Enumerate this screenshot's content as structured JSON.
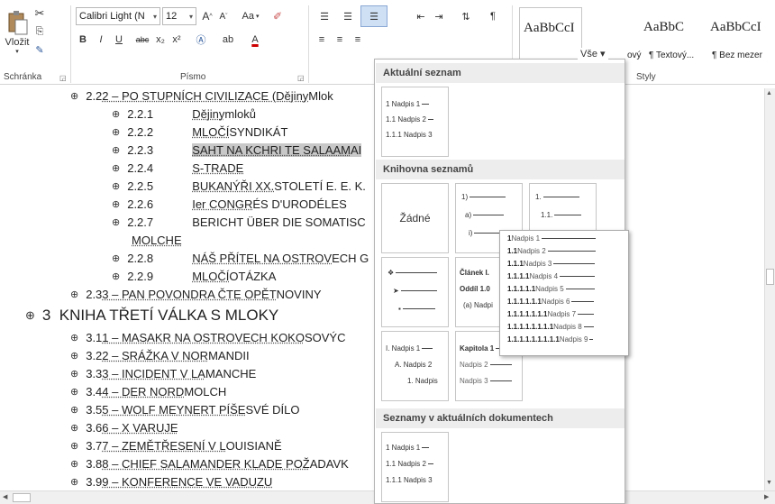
{
  "ribbon": {
    "clipboard": {
      "paste_label": "Vložit",
      "group_label": "Schránka"
    },
    "font": {
      "font_name": "Calibri Light (N",
      "font_size": "12",
      "group_label": "Písmo",
      "change_case": "Aa",
      "format_buttons": [
        "B",
        "I",
        "U",
        "abc",
        "x₂",
        "x²"
      ]
    },
    "paragraph": {
      "group_label": ""
    },
    "styles": {
      "group_label": "Styly",
      "gallery": [
        {
          "preview": "AaBbCcI",
          "name": ""
        },
        {
          "preview": "AaBbC`",
          "name": "ový"
        },
        {
          "preview": "AaBbC`",
          "name": "¶ Textový..."
        },
        {
          "preview": "AaBbCcI",
          "name": "¶ Bez mezer"
        }
      ]
    }
  },
  "document": {
    "lines": [
      {
        "id": "l1",
        "num": "2.22",
        "text_pre": "2.2",
        "text_u": "2 – PO STUPNÍCH CIVILIZACE (Dějiny",
        "text_post": " Mlok"
      },
      {
        "id": "l2",
        "num": "2.2.1",
        "title_u": "Dějiny",
        "title_post": " mloků"
      },
      {
        "id": "l3",
        "num": "2.2.2",
        "title_u": "MLOČÍ",
        "title_post": " SYNDIKÁT"
      },
      {
        "id": "l4",
        "num": "2.2.3",
        "title_u": "SAHT NA KCHRI TE SALAAM",
        "title_post": " AI"
      },
      {
        "id": "l5",
        "num": "2.2.4",
        "title_u": "S-TRADE",
        "title_post": ""
      },
      {
        "id": "l6",
        "num": "2.2.5",
        "title_u": "BUKANÝŘI XX.",
        "title_post": " STOLETÍ E. E. K."
      },
      {
        "id": "l7",
        "num": "2.2.6",
        "title_u": "Ier CONGR",
        "title_post": "ÉS D'URODÉLES"
      },
      {
        "id": "l8",
        "num": "2.2.7",
        "title_u": "",
        "title_post": "BERICHT ÜBER DIE SOMATISC"
      },
      {
        "id": "l8b",
        "text": "MOLCHE"
      },
      {
        "id": "l9",
        "num": "2.2.8",
        "title_u": "NÁŠ PŘÍTEL NA OSTROV",
        "title_post": "ECH G"
      },
      {
        "id": "l10",
        "num": "2.2.9",
        "title_u": "MLOČÍ",
        "title_post": " OTÁZKA"
      },
      {
        "id": "l11",
        "text_pre": "2.3",
        "text_u": "3 – PAN POVONDRA ČTE OPĚT",
        "text_post": " NOVINY"
      },
      {
        "id": "h3",
        "text": "3  KNIHA TŘETÍ VÁLKA S MLOKY"
      },
      {
        "id": "l12",
        "text_pre": "3.1",
        "text_u": "1 – MASAKR NA OSTROVECH KOKO",
        "text_post": "SOVÝC"
      },
      {
        "id": "l13",
        "text_pre": "3.2",
        "text_u": "2 – SRÁŽKA V NOR",
        "text_post": "MANDII"
      },
      {
        "id": "l14",
        "text_pre": "3.3",
        "text_u": "3 – INCIDENT V LA ",
        "text_post": "MANCHE"
      },
      {
        "id": "l15",
        "text_pre": "3.4",
        "text_u": "4 – DER NORD",
        "text_post": "MOLCH"
      },
      {
        "id": "l16",
        "text_pre": "3.5",
        "text_u": "5 – WOLF MEYNERT PÍŠE",
        "text_post": " SVÉ DÍLO"
      },
      {
        "id": "l17",
        "text_pre": "3.6",
        "text_u": "6 – X VARUJE",
        "text_post": ""
      },
      {
        "id": "l18",
        "text_pre": "3.7",
        "text_u": "7 – ZEMĚTŘESENÍ V L",
        "text_post": "OUISIANĚ"
      },
      {
        "id": "l19",
        "text_pre": "3.8",
        "text_u": "8 – CHIEF SALAMANDER KLADE POŽ",
        "text_post": "ADAVK"
      },
      {
        "id": "l20",
        "text_pre": "3.9",
        "text_u": "9 – KONFERENCE VE VADUZU",
        "text_post": ""
      }
    ]
  },
  "dropdown": {
    "filter_label": "Vše ▾",
    "sections": {
      "current": "Aktuální seznam",
      "library": "Knihovna seznamů",
      "documents": "Seznamy v aktuálních dokumentech"
    },
    "none_label": "Žádné",
    "thumb_current": [
      "1 Nadpis 1",
      "1.1 Nadpis 2",
      "1.1.1 Nadpis 3"
    ],
    "thumb_paren": [
      "1)",
      "a)",
      "i)"
    ],
    "thumb_dots": [
      "1.",
      "1.1."
    ],
    "thumb_article": [
      "Článek I.",
      "Oddíl 1.0",
      "(a) Nadpi"
    ],
    "thumb_roman": [
      "I. Nadpis 1",
      "A. Nadpis 2",
      "1. Nadpis"
    ],
    "thumb_chapter": [
      "Kapitola 1",
      "Nadpis 2",
      "Nadpis 3"
    ],
    "thumb_doc": [
      "1 Nadpis 1",
      "1.1 Nadpis 2",
      "1.1.1 Nadpis 3"
    ],
    "flyout": [
      {
        "num": "1",
        "label": "Nadpis 1"
      },
      {
        "num": "1.1",
        "label": "Nadpis 2"
      },
      {
        "num": "1.1.1",
        "label": "Nadpis 3"
      },
      {
        "num": "1.1.1.1",
        "label": "Nadpis 4"
      },
      {
        "num": "1.1.1.1.1",
        "label": "Nadpis 5"
      },
      {
        "num": "1.1.1.1.1.1",
        "label": "Nadpis 6"
      },
      {
        "num": "1.1.1.1.1.1.1",
        "label": "Nadpis 7"
      },
      {
        "num": "1.1.1.1.1.1.1.1",
        "label": "Nadpis 8"
      },
      {
        "num": "1.1.1.1.1.1.1.1.1",
        "label": "Nadpis 9"
      }
    ]
  },
  "colors": {
    "accent": "#2b579a",
    "selection": "#c8c8c8"
  }
}
